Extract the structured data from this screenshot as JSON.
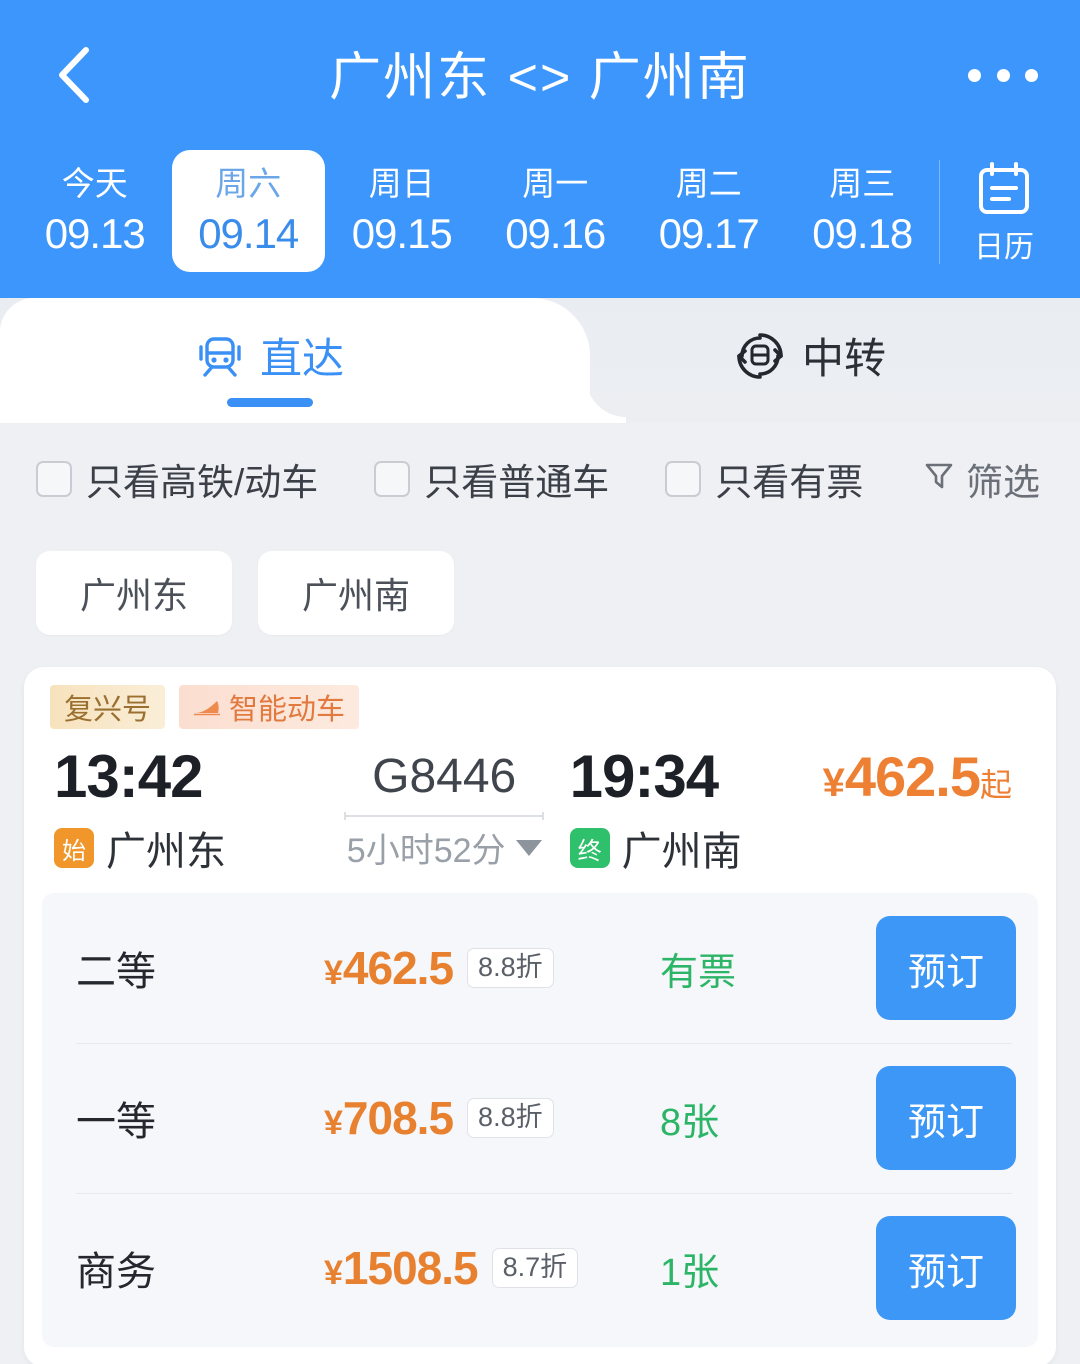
{
  "header": {
    "back_icon": "chevron-left-icon",
    "title": "广州东 <> 广州南",
    "more_icon": "more-dots-icon",
    "dates": [
      {
        "weekday": "今天",
        "date": "09.13",
        "active": false
      },
      {
        "weekday": "周六",
        "date": "09.14",
        "active": true
      },
      {
        "weekday": "周日",
        "date": "09.15",
        "active": false
      },
      {
        "weekday": "周一",
        "date": "09.16",
        "active": false
      },
      {
        "weekday": "周二",
        "date": "09.17",
        "active": false
      },
      {
        "weekday": "周三",
        "date": "09.18",
        "active": false
      }
    ],
    "calendar": {
      "icon": "calendar-icon",
      "label": "日历"
    }
  },
  "tabs": [
    {
      "label": "直达",
      "icon": "train-front-icon",
      "selected": true
    },
    {
      "label": "中转",
      "icon": "transfer-train-icon",
      "selected": false
    }
  ],
  "filters": {
    "checkboxes": [
      {
        "label": "只看高铁/动车",
        "checked": false
      },
      {
        "label": "只看普通车",
        "checked": false
      },
      {
        "label": "只看有票",
        "checked": false
      }
    ],
    "screen": {
      "label": "筛选",
      "icon": "funnel-icon"
    }
  },
  "station_chips": [
    "广州东",
    "广州南"
  ],
  "train": {
    "tags": [
      {
        "label": "复兴号",
        "icon": null
      },
      {
        "label": "智能动车",
        "icon": "bullet-train-icon"
      }
    ],
    "depart_time": "13:42",
    "depart_station": "广州东",
    "depart_badge": "始",
    "train_number": "G8446",
    "duration": "5小时52分",
    "arrive_time": "19:34",
    "arrive_station": "广州南",
    "arrive_badge": "终",
    "price_from": {
      "currency": "¥",
      "amount": "462.5",
      "suffix": "起"
    },
    "seats": [
      {
        "class": "二等",
        "currency": "¥",
        "price": "462.5",
        "discount": "8.8折",
        "stock": "有票",
        "book_label": "预订"
      },
      {
        "class": "一等",
        "currency": "¥",
        "price": "708.5",
        "discount": "8.8折",
        "stock": "8张",
        "book_label": "预订"
      },
      {
        "class": "商务",
        "currency": "¥",
        "price": "1508.5",
        "discount": "8.7折",
        "stock": "1张",
        "book_label": "预订"
      }
    ]
  },
  "colors": {
    "brand_blue": "#3d96fc",
    "accent_orange": "#e8812f",
    "stock_green": "#2db567",
    "tab_blue": "#3a90f5"
  }
}
